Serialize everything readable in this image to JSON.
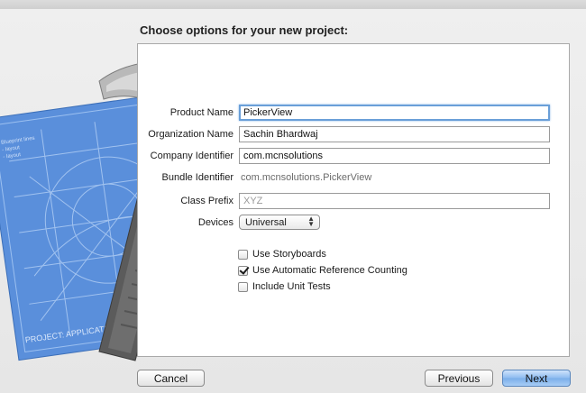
{
  "sheet": {
    "heading": "Choose options for your new project:"
  },
  "illustration": {
    "blueprint_text": "PROJECT: APPLICATION.APP"
  },
  "form": {
    "product_name": {
      "label": "Product Name",
      "value": "PickerView"
    },
    "organization_name": {
      "label": "Organization Name",
      "value": "Sachin Bhardwaj"
    },
    "company_identifier": {
      "label": "Company Identifier",
      "value": "com.mcnsolutions"
    },
    "bundle_identifier": {
      "label": "Bundle Identifier",
      "value": "com.mcnsolutions.PickerView"
    },
    "class_prefix": {
      "label": "Class Prefix",
      "value": "",
      "placeholder": "XYZ"
    },
    "devices": {
      "label": "Devices",
      "selected": "Universal"
    }
  },
  "options": [
    {
      "label": "Use Storyboards",
      "checked": false
    },
    {
      "label": "Use Automatic Reference Counting",
      "checked": true
    },
    {
      "label": "Include Unit Tests",
      "checked": false
    }
  ],
  "buttons": {
    "cancel": "Cancel",
    "previous": "Previous",
    "next": "Next"
  },
  "colors": {
    "focus_ring": "#6a9fd8",
    "primary_button": "#8dbbf0",
    "blueprint": "#4f86d6"
  },
  "icons": {
    "devices_popup": "up-down-chevron-icon",
    "illustration": "hammer-blueprint-icon"
  }
}
